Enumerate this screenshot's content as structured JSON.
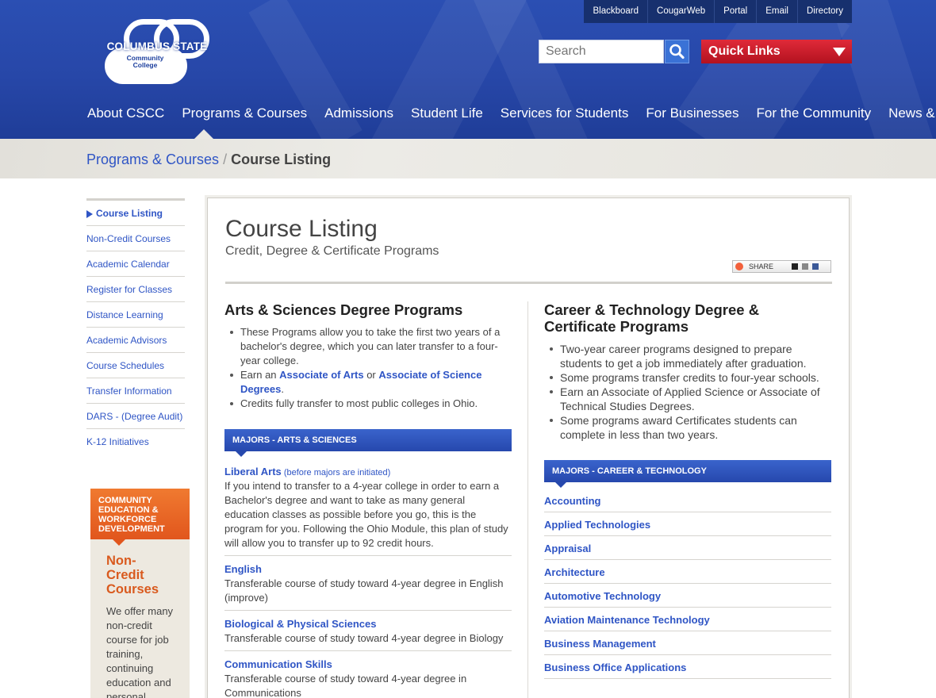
{
  "topbar": [
    "Blackboard",
    "CougarWeb",
    "Portal",
    "Email",
    "Directory"
  ],
  "logo": {
    "name": "COLUMBUS STATE",
    "line2": "Community",
    "line3": "College"
  },
  "search": {
    "placeholder": "Search"
  },
  "quick_links": "Quick Links",
  "nav": [
    "About CSCC",
    "Programs & Courses",
    "Admissions",
    "Student Life",
    "Services for Students",
    "For Businesses",
    "For the Community",
    "News & Events"
  ],
  "breadcrumb": {
    "parent": "Programs & Courses",
    "sep": "/",
    "current": "Course Listing"
  },
  "sidebar": [
    "Course Listing",
    "Non-Credit Courses",
    "Academic Calendar",
    "Register for Classes",
    "Distance Learning",
    "Academic Advisors",
    "Course Schedules",
    "Transfer Information",
    "DARS - (Degree Audit)",
    "K-12 Initiatives"
  ],
  "promo": {
    "header": "COMMUNITY EDUCATION & WORKFORCE DEVELOPMENT",
    "title": "Non-Credit Courses",
    "text": "We offer many non-credit course for job training, continuing education and personal development."
  },
  "page": {
    "title": "Course Listing",
    "subtitle": "Credit, Degree & Certificate Programs",
    "share": "SHARE"
  },
  "arts": {
    "heading": "Arts & Sciences Degree Programs",
    "b1": "These Programs allow you to take the first two years of a bachelor's degree, which you can later transfer to a four-year college.",
    "b2_pre": "Earn an ",
    "b2_link1": "Associate of Arts",
    "b2_mid": " or ",
    "b2_link2": "Associate of Science Degrees",
    "b2_post": ".",
    "b3": "Credits fully transfer to most public colleges in Ohio.",
    "band": "MAJORS - ARTS & SCIENCES",
    "majors": [
      {
        "title": "Liberal Arts",
        "note": " (before majors are initiated)",
        "desc": "If you intend to transfer to a 4-year college in order to earn a Bachelor's degree and want to take as many general education classes as possible before you go, this is the program for you. Following the Ohio Module, this plan of study will allow you to transfer up to 92 credit hours."
      },
      {
        "title": "English",
        "note": "",
        "desc": "Transferable course of study toward 4-year degree in English (improve)"
      },
      {
        "title": "Biological & Physical Sciences",
        "note": "",
        "desc": "Transferable course of study toward 4-year degree in Biology"
      },
      {
        "title": "Communication Skills",
        "note": "",
        "desc": "Transferable course of study toward 4-year degree in Communications"
      }
    ]
  },
  "career": {
    "heading": "Career & Technology Degree & Certificate Programs",
    "bullets": [
      "Two-year career programs designed to prepare students to get a job immediately after graduation.",
      "Some programs transfer credits to four-year schools.",
      "Earn an Associate of Applied Science or Associate of Technical Studies Degrees.",
      "Some programs award Certificates students can complete in less than two years."
    ],
    "band": "MAJORS - CAREER & TECHNOLOGY",
    "links": [
      "Accounting",
      "Applied Technologies",
      "Appraisal",
      "Architecture",
      "Automotive Technology",
      "Aviation Maintenance Technology",
      "Business Management",
      "Business Office Applications"
    ]
  },
  "colors": {
    "header_blue": "#2747a8",
    "link_blue": "#2f55c5",
    "quick_red": "#c81a28",
    "promo_orange": "#e1561d"
  }
}
